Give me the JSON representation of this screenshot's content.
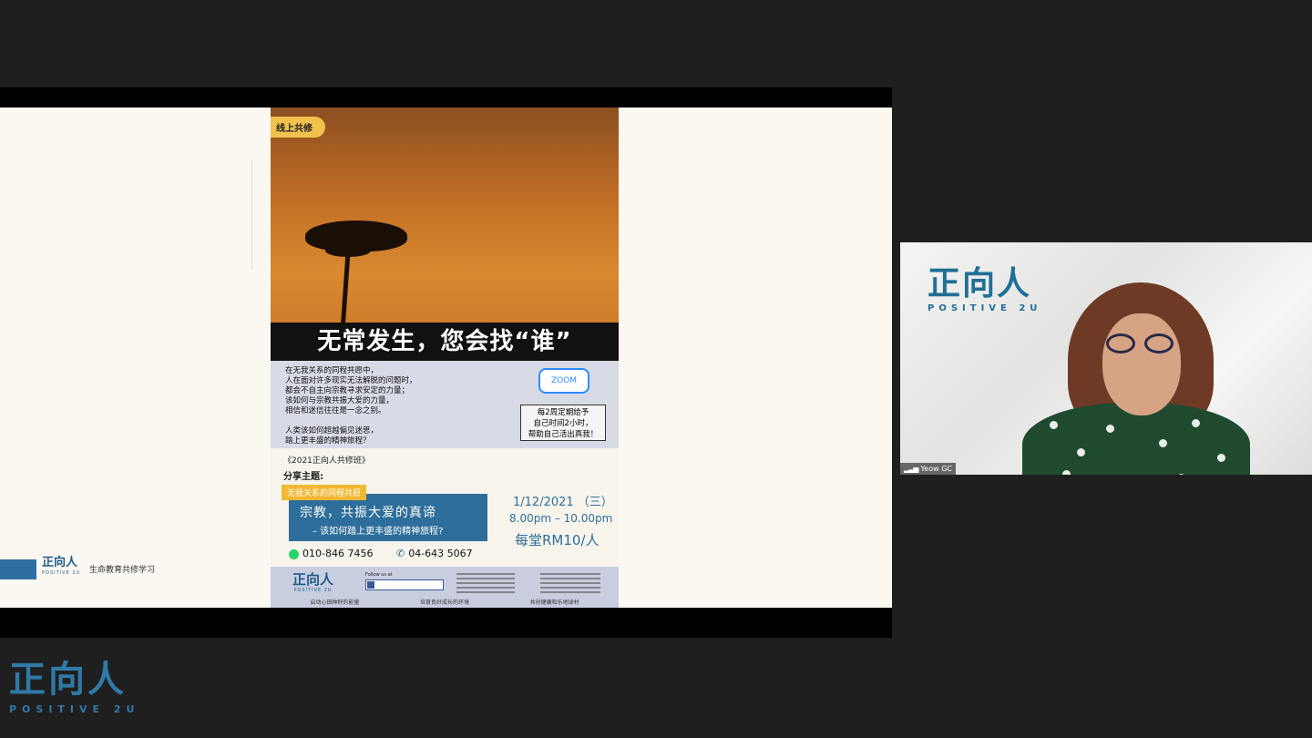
{
  "shared_screen": {
    "slide_footer": {
      "logo": "正向人",
      "logo_en": "POSITIVE 2U",
      "caption": "生命教育共修学习"
    },
    "poster": {
      "tag": "线上共修",
      "headline": "无常发生，您会找“谁”",
      "intro": "在无我关系的同程共愿中，\n人在面对许多现实无法解脱的问题时，\n都会不自主向宗教寻求安定的力量；\n该如何与宗教共振大爱的力量，\n相信和迷信往往是一念之别。\n\n人类该如何超越偏见迷思，\n踏上更丰盛的精神旅程？",
      "zoom_label": "ZOOM",
      "promo": "每2周定期给予\n自己时间2小时，\n帮助自己活出真我！",
      "series": "《2021正向人共修班》",
      "share_label": "分享主题:",
      "theme_tag": "无我关系的同程共愿",
      "topic_main": "宗教，共振大爱的真谛",
      "topic_sub": "– 该如何踏上更丰盛的精神旅程?",
      "date": "1/12/2021 （三）",
      "time": "8.00pm – 10.00pm",
      "price": "每堂RM10/人",
      "whatsapp": "010-846 7456",
      "phone": "04-643 5067",
      "footer": {
        "logo": "正向人",
        "logo_en": "POSITIVE 2U",
        "follow": "Follow us at",
        "tags": [
          "启动心田种籽的能量",
          "培育良好成长的环境",
          "共创健康和乐地球村"
        ]
      }
    }
  },
  "video_tile": {
    "watermark_cn": "正向人",
    "watermark_en": "POSITIVE 2U",
    "participant_name": "Yeow GC"
  },
  "brand": {
    "cn": "正向人",
    "en": "POSITIVE 2U"
  },
  "colors": {
    "background": "#1f1f1f",
    "brand_blue": "#2f7aa6",
    "accent_orange": "#f2a22a"
  }
}
